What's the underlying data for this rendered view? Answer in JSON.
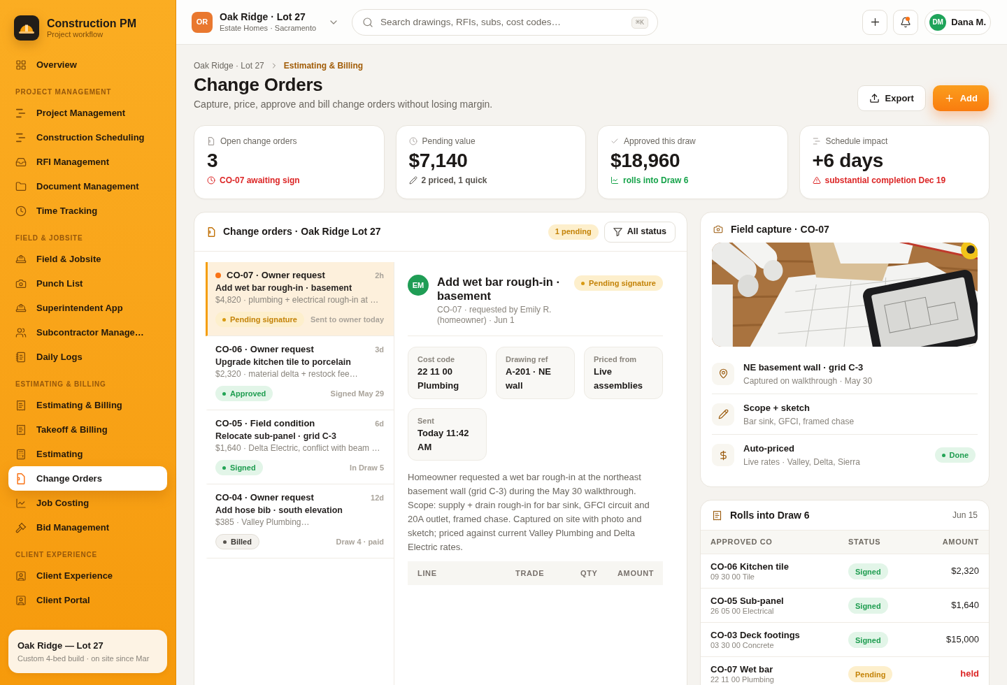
{
  "sidebar": {
    "brand": {
      "name": "Construction PM",
      "subtitle": "Project workflow"
    },
    "top_items": [
      {
        "label": "Overview",
        "selected": false
      }
    ],
    "sections": [
      {
        "title": "PROJECT MANAGEMENT",
        "items": [
          {
            "label": "Project Management",
            "selected": false
          },
          {
            "label": "Construction Scheduling",
            "selected": false
          },
          {
            "label": "RFI Management",
            "selected": false
          },
          {
            "label": "Document Management",
            "selected": false
          },
          {
            "label": "Time Tracking",
            "selected": false
          }
        ]
      },
      {
        "title": "FIELD & JOBSITE",
        "items": [
          {
            "label": "Field & Jobsite",
            "selected": false
          },
          {
            "label": "Punch List",
            "selected": false
          },
          {
            "label": "Superintendent App",
            "selected": false
          },
          {
            "label": "Subcontractor Manage…",
            "selected": false
          },
          {
            "label": "Daily Logs",
            "selected": false
          }
        ]
      },
      {
        "title": "ESTIMATING & BILLING",
        "items": [
          {
            "label": "Estimating & Billing",
            "selected": false
          },
          {
            "label": "Takeoff & Billing",
            "selected": false
          },
          {
            "label": "Estimating",
            "selected": false
          },
          {
            "label": "Change Orders",
            "selected": true
          },
          {
            "label": "Job Costing",
            "selected": false
          },
          {
            "label": "Bid Management",
            "selected": false
          }
        ]
      },
      {
        "title": "CLIENT EXPERIENCE",
        "items": [
          {
            "label": "Client Experience",
            "selected": false
          },
          {
            "label": "Client Portal",
            "selected": false
          }
        ]
      }
    ],
    "project_card": {
      "title": "Oak Ridge — Lot 27",
      "subtitle": "Custom 4-bed build · on site since Mar"
    }
  },
  "topbar": {
    "project": {
      "initials": "OR",
      "name": "Oak Ridge · Lot 27",
      "subtitle": "Estate Homes · Sacramento"
    },
    "search": {
      "placeholder": "Search drawings, RFIs, subs, cost codes…",
      "shortcut": "⌘K"
    },
    "notifications": {
      "unread": true
    },
    "user": {
      "initials": "DM",
      "name": "Dana M."
    }
  },
  "page_header": {
    "breadcrumb": [
      {
        "label": "Oak Ridge · Lot 27",
        "current": false
      },
      {
        "label": "Estimating & Billing",
        "current": true
      }
    ],
    "title": "Change Orders",
    "subtitle": "Capture, price, approve and bill change orders without losing margin.",
    "actions": [
      {
        "label": "Export",
        "kind": "secondary"
      },
      {
        "label": "Add",
        "kind": "primary"
      }
    ]
  },
  "kpis": [
    {
      "label": "Open change orders",
      "value": "3",
      "note": "CO-07 awaiting sign",
      "color": "#dc2626"
    },
    {
      "label": "Pending value",
      "value": "$7,140",
      "note": "2 priced, 1 quick",
      "color": "#57534e"
    },
    {
      "label": "Approved this draw",
      "value": "$18,960",
      "note": "rolls into Draw 6",
      "color": "#16a34a"
    },
    {
      "label": "Schedule impact",
      "value": "+6 days",
      "note": "substantial completion Dec 19",
      "color": "#dc2626"
    }
  ],
  "change_orders": {
    "title": "Change orders · Oak Ridge Lot 27",
    "pending_badge": "1 pending",
    "filter": "All status",
    "items": [
      {
        "title": "CO-07 · Owner request",
        "age": "2h",
        "summary": "Add wet bar rough-in · basement",
        "detail": "$4,820 · plumbing + electrical rough-in at …",
        "status": {
          "label": "Pending signature",
          "kind": "pending"
        },
        "note": "Sent to owner today",
        "selected": true
      },
      {
        "title": "CO-06 · Owner request",
        "age": "3d",
        "summary": "Upgrade kitchen tile to porcelain",
        "detail": "$2,320 · material delta + restock fee…",
        "status": {
          "label": "Approved",
          "kind": "approved"
        },
        "note": "Signed May 29",
        "selected": false
      },
      {
        "title": "CO-05 · Field condition",
        "age": "6d",
        "summary": "Relocate sub-panel · grid C-3",
        "detail": "$1,640 · Delta Electric, conflict with beam …",
        "status": {
          "label": "Signed",
          "kind": "signed"
        },
        "note": "In Draw 5",
        "selected": false
      },
      {
        "title": "CO-04 · Owner request",
        "age": "12d",
        "summary": "Add hose bib · south elevation",
        "detail": "$385 · Valley Plumbing…",
        "status": {
          "label": "Billed",
          "kind": "billed"
        },
        "note": "Draw 4 · paid",
        "selected": false
      }
    ],
    "detail": {
      "avatar": "EM",
      "title": "Add wet bar rough-in · basement",
      "status": {
        "label": "Pending signature",
        "kind": "pending"
      },
      "meta": "CO-07 · requested by Emily R. (homeowner) · Jun 1",
      "fields": [
        {
          "label": "Cost code",
          "value": "22 11 00 Plumbing"
        },
        {
          "label": "Drawing ref",
          "value": "A-201 · NE wall"
        },
        {
          "label": "Priced from",
          "value": "Live assemblies"
        },
        {
          "label": "Sent",
          "value": "Today 11:42 AM"
        }
      ],
      "description": "Homeowner requested a wet bar rough-in at the northeast basement wall (grid C-3) during the May 30 walkthrough. Scope: supply + drain rough-in for bar sink, GFCI circuit and 20A outlet, framed chase. Captured on site with photo and sketch; priced against current Valley Plumbing and Delta Electric rates.",
      "line_columns": [
        "LINE",
        "TRADE",
        "QTY",
        "AMOUNT"
      ]
    }
  },
  "field_capture": {
    "title": "Field capture · CO-07",
    "steps": [
      {
        "title": "NE basement wall · grid C-3",
        "subtitle": "Captured on walkthrough · May 30"
      },
      {
        "title": "Scope + sketch",
        "subtitle": "Bar sink, GFCI, framed chase"
      },
      {
        "title": "Auto-priced",
        "subtitle": "Live rates · Valley, Delta, Sierra",
        "badge": {
          "label": "Done",
          "kind": "done"
        }
      }
    ]
  },
  "draw": {
    "title": "Rolls into Draw 6",
    "date": "Jun 15",
    "columns": [
      "APPROVED CO",
      "STATUS",
      "AMOUNT"
    ],
    "rows": [
      {
        "name": "CO-06 Kitchen tile",
        "code": "09 30 00 Tile",
        "status": {
          "label": "Signed",
          "kind": "signed"
        },
        "amount": "$2,320"
      },
      {
        "name": "CO-05 Sub-panel",
        "code": "26 05 00 Electrical",
        "status": {
          "label": "Signed",
          "kind": "signed"
        },
        "amount": "$1,640"
      },
      {
        "name": "CO-03 Deck footings",
        "code": "03 30 00 Concrete",
        "status": {
          "label": "Signed",
          "kind": "signed"
        },
        "amount": "$15,000"
      },
      {
        "name": "CO-07 Wet bar",
        "code": "22 11 00 Plumbing",
        "status": {
          "label": "Pending",
          "kind": "pending"
        },
        "amount": "held"
      }
    ]
  }
}
